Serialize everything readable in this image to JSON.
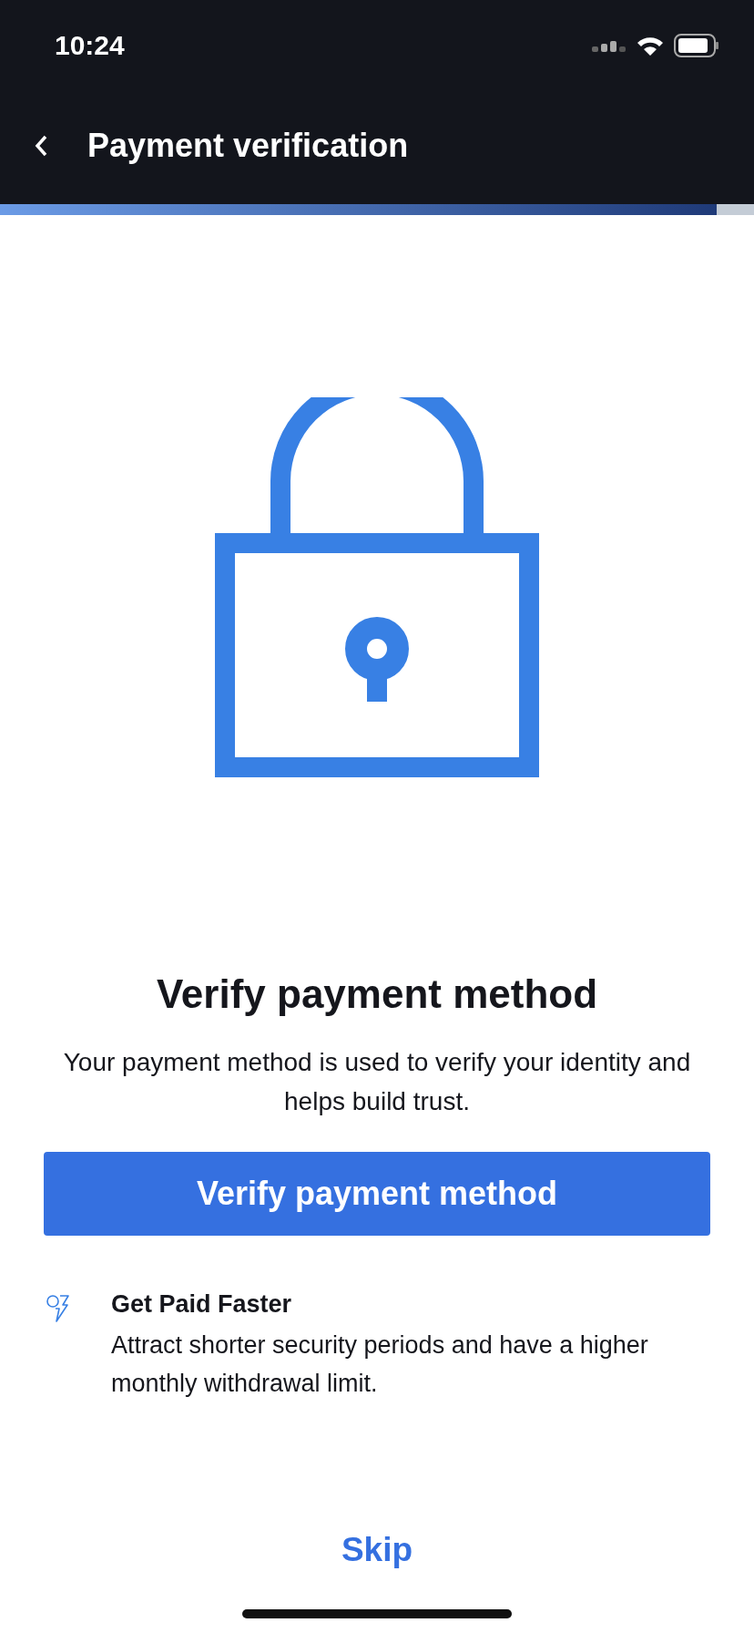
{
  "status_bar": {
    "time": "10:24"
  },
  "header": {
    "title": "Payment verification"
  },
  "progress": {
    "level": 0.95
  },
  "heading": "Verify payment method",
  "description": "Your payment method is used to verify your identity and helps build trust.",
  "primary_button": "Verify payment method",
  "features": [
    {
      "title": "Get Paid Faster",
      "text": "Attract shorter security periods and have a higher monthly withdrawal limit."
    }
  ],
  "skip_button": "Skip"
}
